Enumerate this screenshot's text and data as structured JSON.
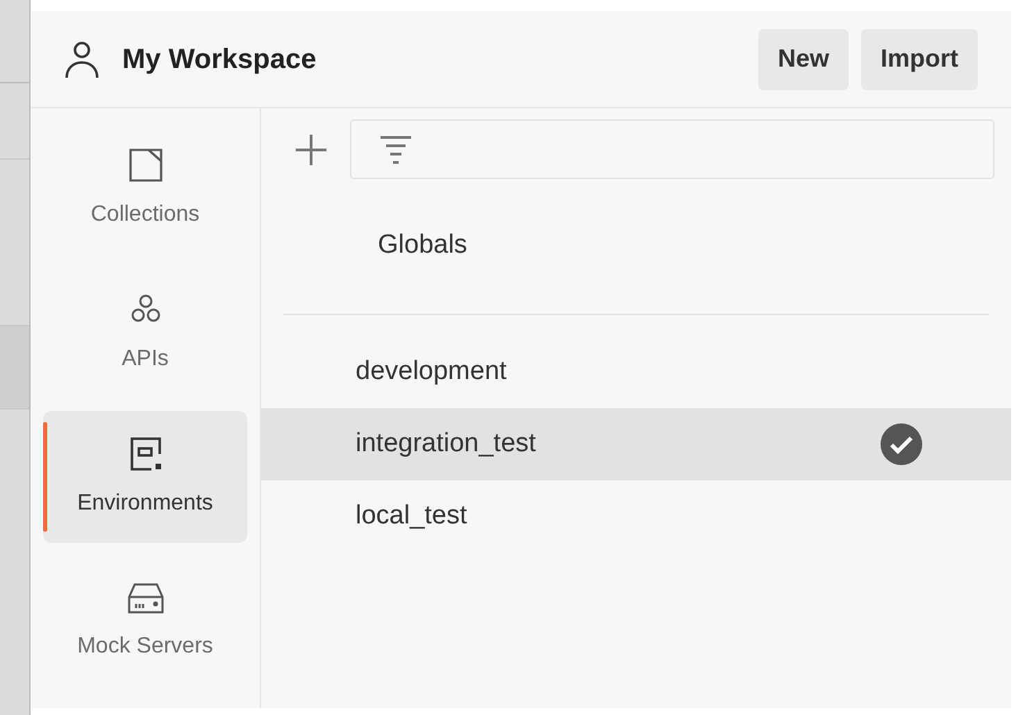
{
  "header": {
    "title": "My Workspace",
    "buttons": [
      "New",
      "Import"
    ]
  },
  "nav": [
    {
      "label": "Collections",
      "kind": "collection",
      "selected": false
    },
    {
      "label": "APIs",
      "kind": "api",
      "selected": false
    },
    {
      "label": "Environments",
      "kind": "environment",
      "selected": true
    },
    {
      "label": "Mock Servers",
      "kind": "mock",
      "selected": false
    }
  ],
  "globals": {
    "label": "Globals"
  },
  "environments": [
    {
      "name": "development",
      "selected": false,
      "active": false
    },
    {
      "name": "integration_test",
      "selected": true,
      "active": true
    },
    {
      "name": "local_test",
      "selected": false,
      "active": false
    }
  ]
}
